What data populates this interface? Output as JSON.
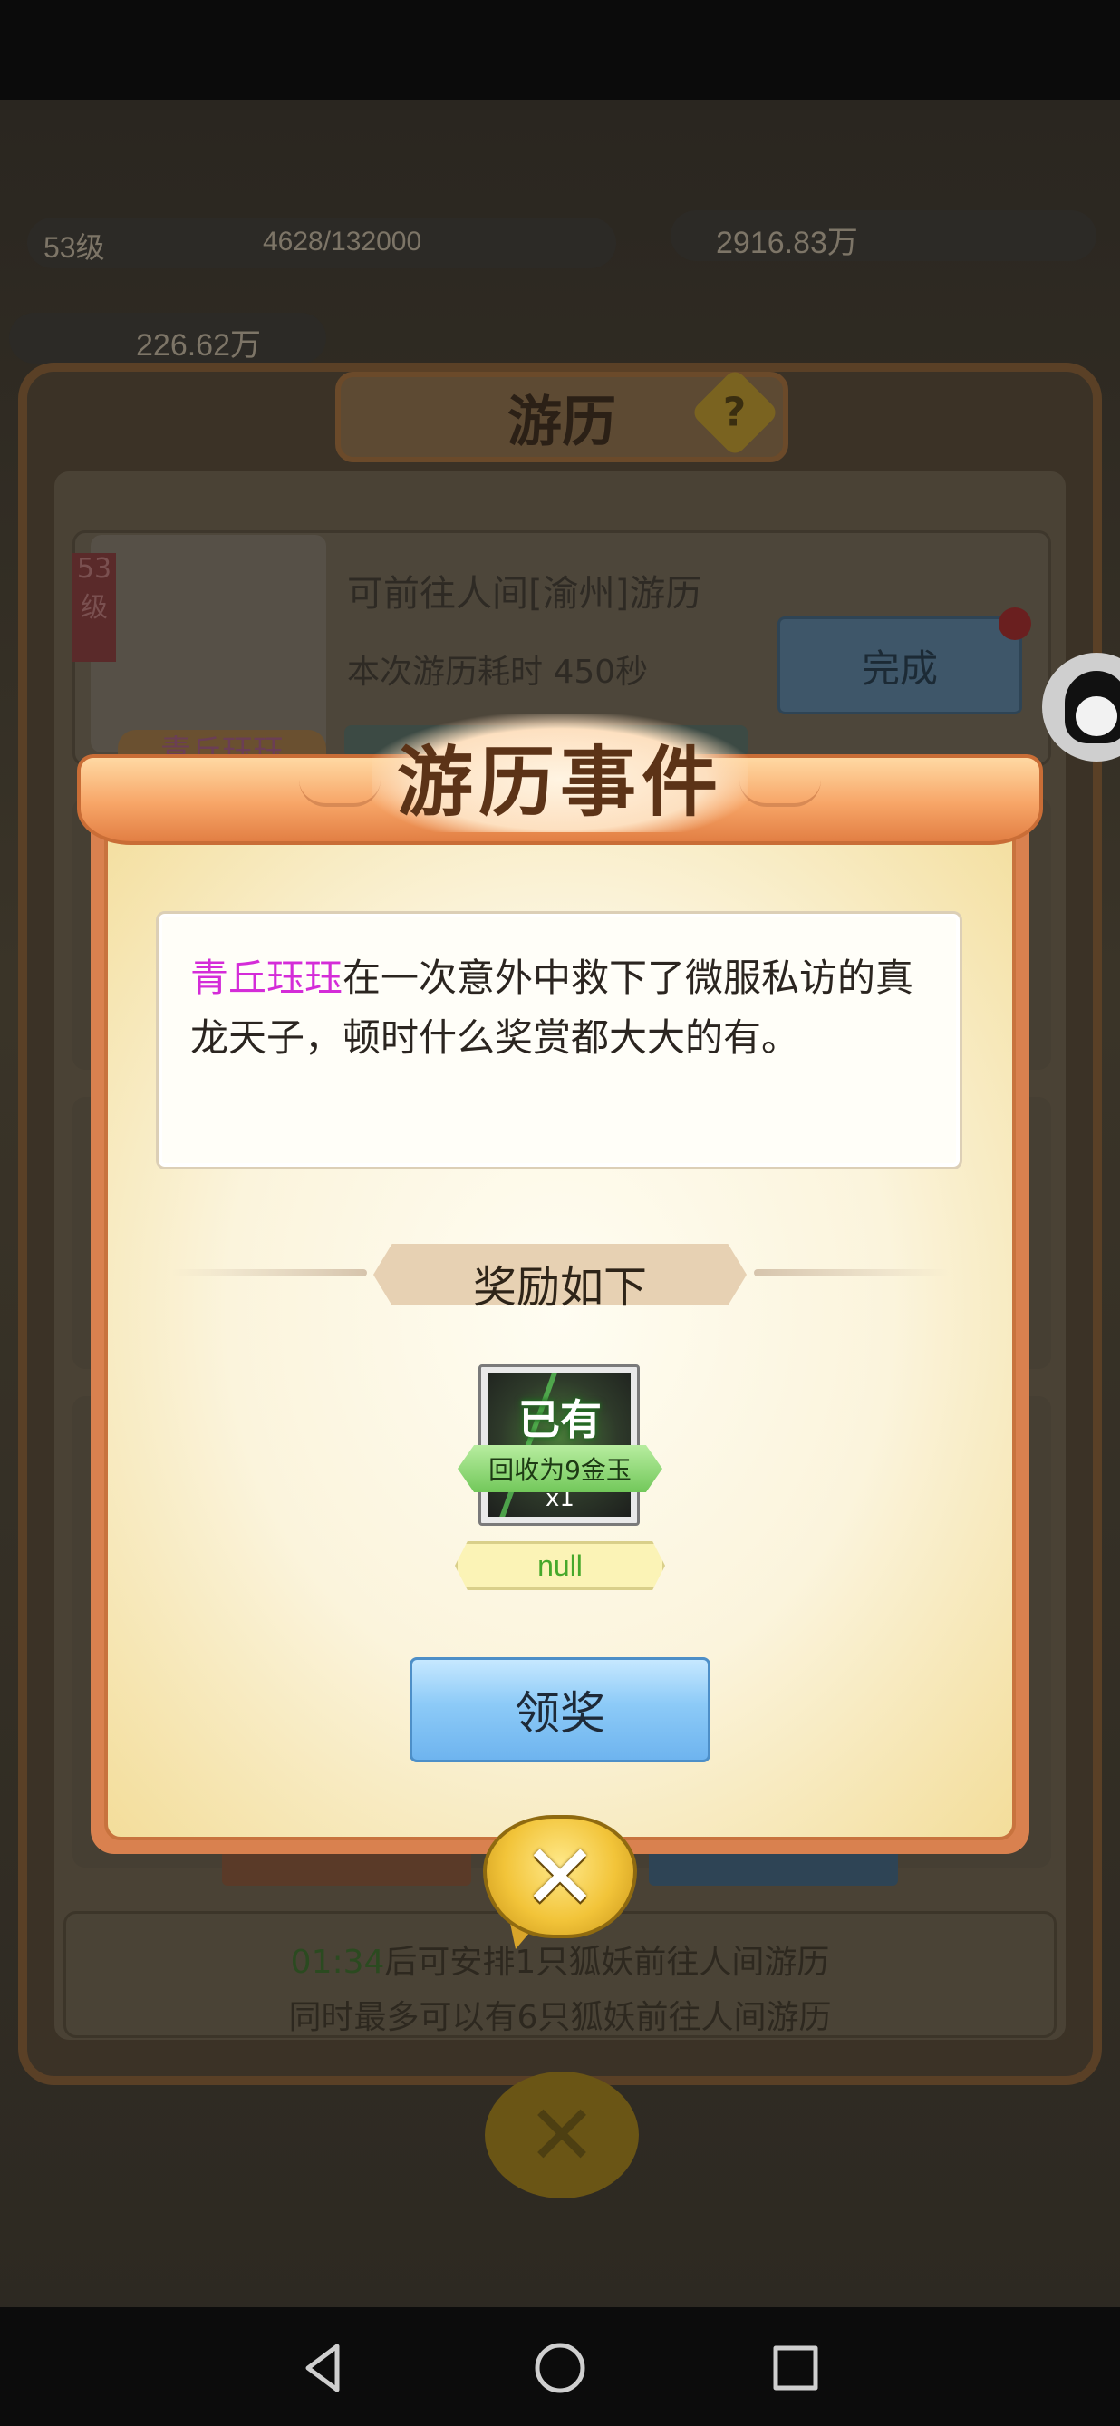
{
  "background": {
    "travel_title": "游历",
    "help_icon": "?",
    "slot": {
      "level": "53级",
      "destination_text": "可前往人间[渝州]游历",
      "duration_text": "本次游历耗时 450秒",
      "complete_button": "完成",
      "fox_name": "青丘珏珏"
    },
    "footer": {
      "timer": "01:34",
      "line1_suffix": "后可安排1只狐妖前往人间游历",
      "line2": "同时最多可以有6只狐妖前往人间游历"
    },
    "hud": {
      "level": "53级",
      "exp": "4628/132000",
      "currency": "2916.83万",
      "power": "226.62万"
    }
  },
  "dialog": {
    "title": "游历事件",
    "event": {
      "hero_name": "青丘珏珏",
      "text": "在一次意外中救下了微服私访的真龙天子，顿时什么奖赏都大大的有。"
    },
    "reward_header": "奖励如下",
    "reward": {
      "owned_label": "已有",
      "recycle_label": "回收为9金玉",
      "quantity": "x1",
      "name": "null"
    },
    "claim_button": "领奖",
    "close_icon": "close-icon"
  },
  "nav": {
    "back_icon": "back-triangle-icon",
    "home_icon": "home-circle-icon",
    "recent_icon": "recent-square-icon"
  },
  "colors": {
    "hero_name": "#d42cd8",
    "reward_name": "#46a82b",
    "claim_button": "#8ccaf7",
    "dialog_frame": "#d9814f"
  }
}
